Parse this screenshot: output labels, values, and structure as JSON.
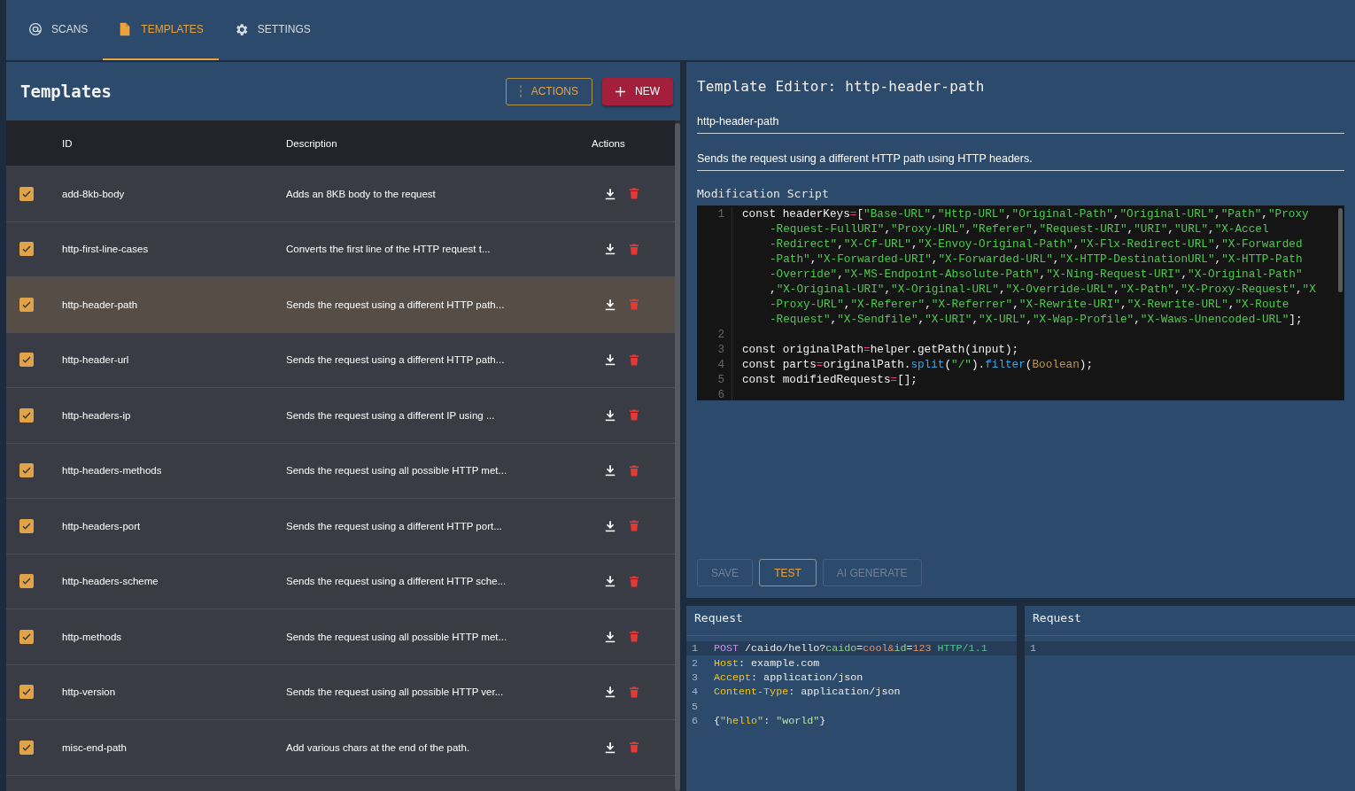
{
  "nav": {
    "tabs": [
      {
        "label": "SCANS",
        "kind": "scans",
        "selected": false
      },
      {
        "label": "TEMPLATES",
        "kind": "templates",
        "selected": true
      },
      {
        "label": "SETTINGS",
        "kind": "settings",
        "selected": false
      }
    ]
  },
  "templates": {
    "title": "Templates",
    "actions": [
      {
        "label": "ACTIONS",
        "kind": "menu"
      },
      {
        "label": "NEW",
        "kind": "add"
      }
    ],
    "columns": [
      "ID",
      "Description",
      "Actions"
    ],
    "rows": [
      {
        "id": "add-8kb-body",
        "description": "Adds an 8KB body to the request",
        "checked": true,
        "selected": false
      },
      {
        "id": "http-first-line-cases",
        "description": "Converts the first line of the HTTP request t...",
        "checked": true,
        "selected": false
      },
      {
        "id": "http-header-path",
        "description": "Sends the request using a different HTTP path...",
        "checked": true,
        "selected": true
      },
      {
        "id": "http-header-url",
        "description": "Sends the request using a different HTTP path...",
        "checked": true,
        "selected": false
      },
      {
        "id": "http-headers-ip",
        "description": "Sends the request using a different IP using ...",
        "checked": true,
        "selected": false
      },
      {
        "id": "http-headers-methods",
        "description": "Sends the request using all possible HTTP met...",
        "checked": true,
        "selected": false
      },
      {
        "id": "http-headers-port",
        "description": "Sends the request using a different HTTP port...",
        "checked": true,
        "selected": false
      },
      {
        "id": "http-headers-scheme",
        "description": "Sends the request using a different HTTP sche...",
        "checked": true,
        "selected": false
      },
      {
        "id": "http-methods",
        "description": "Sends the request using all possible HTTP met...",
        "checked": true,
        "selected": false
      },
      {
        "id": "http-version",
        "description": "Sends the request using all possible HTTP ver...",
        "checked": true,
        "selected": false
      },
      {
        "id": "misc-end-path",
        "description": "Add various chars at the end of the path.",
        "checked": true,
        "selected": false
      }
    ]
  },
  "editor": {
    "title": "Template Editor: http-header-path",
    "name_field": {
      "value": "http-header-path"
    },
    "description_field": {
      "value": "Sends the request using a different HTTP path using HTTP headers."
    },
    "script": {
      "label": "Modification Script",
      "lines": [
        {
          "number": "1",
          "rows": [
            [
              {
                "text": "const headerKeys=[\"Base-URL\",\"Http-URL\",\"Original-Path\",\"Original-URL\",\"Path\",\"Proxy",
                "kind": "code"
              }
            ],
            [
              {
                "text": "-Request-FullURI\",\"Proxy-URL\",\"Referer\",\"Request-URI\",\"URI\",\"URL\",\"X-Accel",
                "kind": "code"
              }
            ],
            [
              {
                "text": "-Redirect\",\"X-Cf-URL\",\"X-Envoy-Original-Path\",\"X-Flx-Redirect-URL\",\"X-Forwarded",
                "kind": "code"
              }
            ],
            [
              {
                "text": "-Path\",\"X-Forwarded-URI\",\"X-Forwarded-URL\",\"X-HTTP-DestinationURL\",\"X-HTTP-Path",
                "kind": "code"
              }
            ],
            [
              {
                "text": "-Override\",\"X-MS-Endpoint-Absolute-Path\",\"X-Ning-Request-URI\",\"X-Original-Path\"",
                "kind": "code"
              }
            ],
            [
              {
                "text": ",\"X-Original-URI\",\"X-Original-URL\",\"X-Override-URL\",\"X-Path\",\"X-Proxy-Request\",\"X",
                "kind": "code"
              }
            ],
            [
              {
                "text": "-Proxy-URL\",\"X-Referer\",\"X-Referrer\",\"X-Rewrite-URI\",\"X-Rewrite-URL\",\"X-Route",
                "kind": "code"
              }
            ],
            [
              {
                "text": "-Request\",\"X-Sendfile\",\"X-URI\",\"X-URL\",\"X-Wap-Profile\",\"X-Waws-Unencoded-URL\"];",
                "kind": "code"
              }
            ]
          ]
        },
        {
          "number": "2"
        },
        {
          "number": "3",
          "rows": [
            [
              {
                "text": "const originalPath=helper.getPath(input);",
                "kind": "code"
              }
            ]
          ]
        },
        {
          "number": "4",
          "rows": [
            [
              {
                "text": "const parts=originalPath.",
                "kind": "code"
              },
              {
                "text": "split",
                "kind": "fn"
              },
              {
                "text": "(\"/\").",
                "kind": "code"
              },
              {
                "text": "filter",
                "kind": "fn"
              },
              {
                "text": "(",
                "kind": "code"
              },
              {
                "text": "Boolean",
                "kind": "type"
              },
              {
                "text": ");",
                "kind": "code"
              }
            ]
          ]
        },
        {
          "number": "5",
          "rows": [
            [
              {
                "text": "const modifiedRequests=[];",
                "kind": "code"
              }
            ]
          ]
        },
        {
          "number": "6"
        }
      ]
    },
    "buttons": [
      {
        "label": "SAVE",
        "disabled": true
      },
      {
        "label": "TEST",
        "disabled": false
      },
      {
        "label": "AI GENERATE",
        "disabled": true
      }
    ]
  },
  "request_panes": [
    {
      "title": "Request",
      "lines": [
        {
          "number": "1",
          "current": true,
          "tokens": [
            {
              "text": "POST",
              "kind": "method"
            },
            {
              "text": " /caido/hello?",
              "kind": "text"
            },
            {
              "text": "caido",
              "kind": "param"
            },
            {
              "text": "=",
              "kind": "text"
            },
            {
              "text": "cool&",
              "kind": "value"
            },
            {
              "text": "id",
              "kind": "param"
            },
            {
              "text": "=",
              "kind": "text"
            },
            {
              "text": "123 ",
              "kind": "value"
            },
            {
              "text": "HTTP/1.1",
              "kind": "version"
            }
          ]
        },
        {
          "number": "2",
          "current": false,
          "tokens": [
            {
              "text": "Host",
              "kind": "header"
            },
            {
              "text": ": example.com",
              "kind": "text"
            }
          ]
        },
        {
          "number": "3",
          "current": false,
          "tokens": [
            {
              "text": "Accept",
              "kind": "header"
            },
            {
              "text": ": application/json",
              "kind": "text"
            }
          ]
        },
        {
          "number": "4",
          "current": false,
          "tokens": [
            {
              "text": "Content-Type",
              "kind": "header"
            },
            {
              "text": ": application/json",
              "kind": "text"
            }
          ]
        },
        {
          "number": "5",
          "current": false
        },
        {
          "number": "6",
          "current": false,
          "tokens": [
            {
              "text": "{",
              "kind": "text"
            },
            {
              "text": "\"hello\"",
              "kind": "key"
            },
            {
              "text": ": ",
              "kind": "text"
            },
            {
              "text": "\"world\"",
              "kind": "string"
            },
            {
              "text": "}",
              "kind": "text"
            }
          ]
        }
      ]
    },
    {
      "title": "Request",
      "lines": [
        {
          "number": "1",
          "current": true
        }
      ]
    }
  ]
}
